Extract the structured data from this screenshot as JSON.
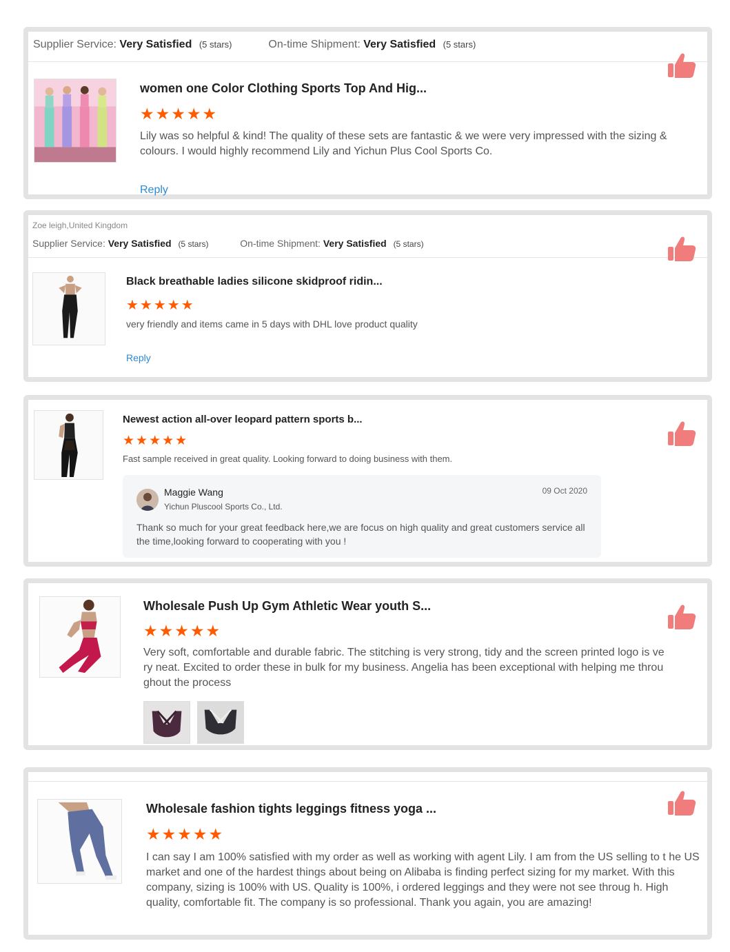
{
  "colors": {
    "accent_star": "#ff5a00",
    "link": "#2a8ad6",
    "thumb_up": "#f07c7c",
    "card_border": "#e3e3e3"
  },
  "icons": {
    "rating": "star-icon",
    "like": "thumb-up-icon"
  },
  "reviews": [
    {
      "reviewer": "",
      "supplier_label": "Supplier Service:",
      "supplier_value": "Very Satisfied",
      "supplier_stars": "(5 stars)",
      "shipment_label": "On-time Shipment:",
      "shipment_value": "Very Satisfied",
      "shipment_stars": "(5 stars)",
      "title": "women one Color Clothing Sports Top And Hig...",
      "stars": "★★★★★",
      "rating": 5,
      "text": "Lily was so helpful & kind! The quality of these sets are fantastic & we were very impressed with the sizing & colours. I would highly recommend Lily and Yichun Plus Cool Sports Co.",
      "reply_label": "Reply"
    },
    {
      "reviewer": "Zoe leigh,United Kingdom",
      "supplier_label": "Supplier Service:",
      "supplier_value": "Very Satisfied",
      "supplier_stars": "(5 stars)",
      "shipment_label": "On-time Shipment:",
      "shipment_value": "Very Satisfied",
      "shipment_stars": "(5 stars)",
      "title": "Black breathable ladies silicone skidproof ridin...",
      "stars": "★★★★★",
      "rating": 5,
      "text": "very friendly and items came in 5 days with DHL love product quality",
      "reply_label": "Reply"
    },
    {
      "title": "Newest action all-over leopard pattern sports b...",
      "stars": "★★★★★",
      "rating": 5,
      "text": "Fast sample received in great quality. Looking forward to doing business with them.",
      "supplier_reply": {
        "name": "Maggie Wang",
        "company": "Yichun Pluscool Sports Co., Ltd.",
        "date": "09 Oct 2020",
        "text": "Thank so much for your great feedback here,we are focus on high quality and great customers service all the time,looking forward to cooperating with you !"
      }
    },
    {
      "title": "Wholesale Push Up Gym Athletic Wear youth S...",
      "stars": "★★★★★",
      "rating": 5,
      "text": "Very soft, comfortable and durable fabric. The stitching is very strong, tidy and the screen printed logo is ve ry neat. Excited to order these in bulk for my business. Angelia has been exceptional with helping me throu ghout  the process"
    },
    {
      "title": "Wholesale fashion tights leggings fitness yoga ...",
      "stars": "★★★★★",
      "rating": 5,
      "text": "I can say I am 100% satisfied with my order as well as working with agent Lily. I am from the US selling to t he US market and one of the hardest things about being on Alibaba is finding perfect sizing for my market. With this company, sizing is 100% with US. Quality is 100%, i ordered leggings and they were not see throug h. High quality, comfortable fit. The company is so professional. Thank you again, you are amazing!"
    }
  ]
}
